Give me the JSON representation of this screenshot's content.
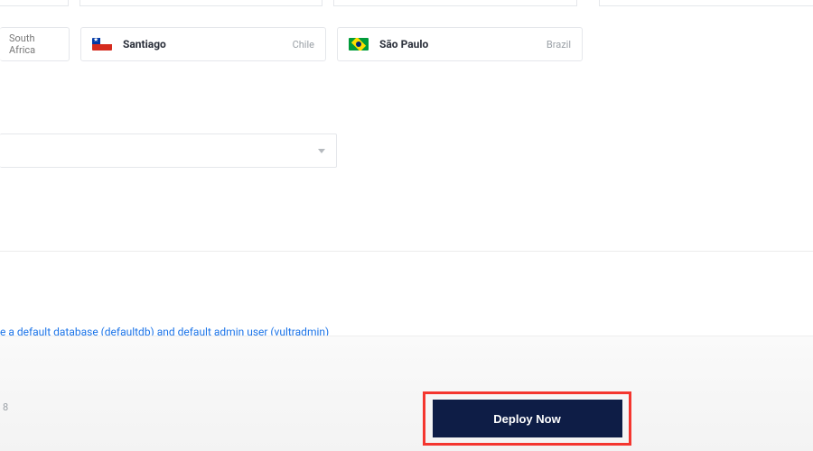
{
  "regions": {
    "south_africa": {
      "country_only": "South Africa"
    },
    "santiago": {
      "city": "Santiago",
      "country": "Chile"
    },
    "sao_paulo": {
      "city": "São Paulo",
      "country": "Brazil"
    }
  },
  "info_text": "e a default database (defaultdb) and default admin user (vultradmin)",
  "footer_char": "8",
  "deploy_label": "Deploy Now"
}
